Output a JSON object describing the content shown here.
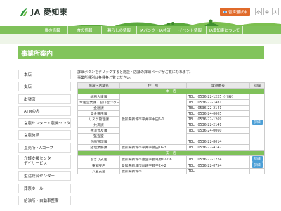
{
  "header": {
    "logo_text": "JA 愛知東",
    "mail_button": "📧 音声通訳申",
    "font_sizes": [
      "小",
      "中",
      "大"
    ]
  },
  "nav": {
    "items": [
      "農の情報",
      "食の情報",
      "暮らしの情報",
      "JAバンク・JA共済",
      "イベント情報",
      "JA愛知東について"
    ]
  },
  "page": {
    "title": "事業所案内"
  },
  "sidebar": {
    "items": [
      "本店",
      "支店",
      "出張店",
      "ATMのみ",
      "営農センター・農機センター",
      "営農施設",
      "直売所・Aコープ",
      "介護支援センター\nデイサービス",
      "生活総合センター",
      "葬祭ホール",
      "給油所・自動車整備"
    ]
  },
  "content": {
    "desc_line1": "詳細ボタンをクリックすると施設・店舗の詳細ページがご覧になれます。",
    "desc_line2": "事業所種別は各種各ご覧ください。",
    "table": {
      "headers": [
        "施設・店舗名",
        "住　所",
        "電話番号",
        "詳細"
      ],
      "sections": [
        {
          "category": "本　店",
          "names": [
            "総務人事課",
            "本店営業課・窓口センター",
            "金融課",
            "資金運用課",
            "リスク管理課",
            "共済課",
            "共済普及課",
            "監査室",
            "企画管理課",
            "経理業務課"
          ],
          "address_main": "愛知県新城市平井字中田5-1",
          "address_last": "愛知県新城市平井字藤田16-3",
          "tel_label": "TEL",
          "phones": [
            "0536-22-1225（代表）",
            "0536-22-1481",
            "0536-22-2141",
            "0536-24-0005",
            "0536-22-1269",
            "0536-22-2141",
            "0536-24-0060",
            "",
            "0536-22-8014",
            "0536-22-4147"
          ],
          "detail": "詳細"
        },
        {
          "category": "支　店",
          "rows": [
            {
              "name": "ちぎり支店",
              "address": "愛知県新城市豊里字長亀原022-6",
              "tel": "TEL",
              "phone": "0536-22-1224",
              "detail": "詳細"
            },
            {
              "name": "東郷支店",
              "address": "愛知県新城市川路字萩平24-2",
              "tel": "TEL",
              "phone": "0536-22-0754",
              "detail": "詳細"
            },
            {
              "name": "八名支店",
              "address": "愛知県新城市",
              "tel": "TEL",
              "phone": "",
              "detail": ""
            }
          ]
        }
      ]
    }
  }
}
